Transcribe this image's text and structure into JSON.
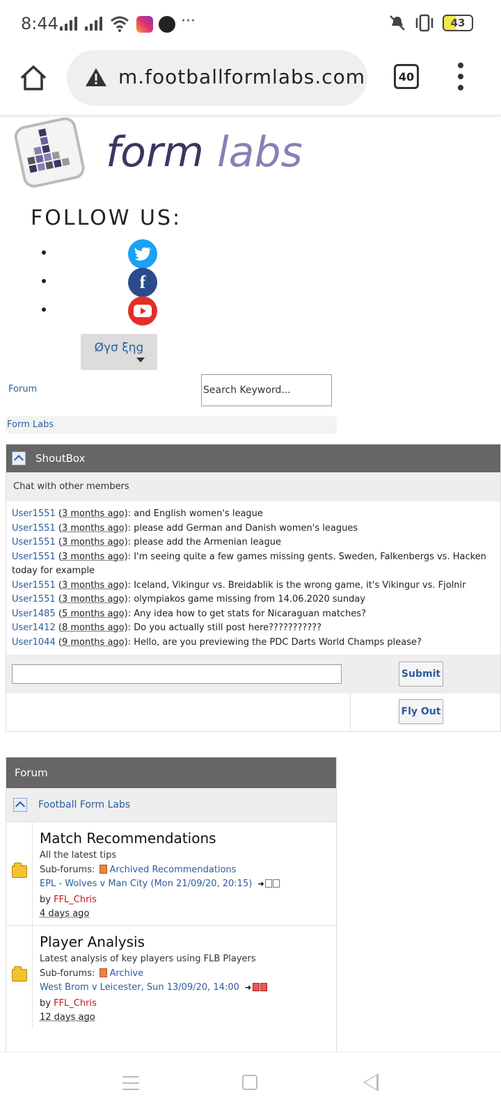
{
  "status_bar": {
    "time": "8:44",
    "more": "···",
    "battery": "43"
  },
  "browser": {
    "url": "m.footballformlabs.com",
    "tab_count": "40"
  },
  "logo": {
    "word1": "form",
    "word2": "labs"
  },
  "follow": {
    "heading": "FOLLOW US:",
    "icons": [
      "twitter-icon",
      "facebook-icon",
      "youtube-icon"
    ]
  },
  "language_button": "Øγσ ξηg",
  "nav": {
    "forum_link": "Forum",
    "search_placeholder": "Search Keyword...",
    "breadcrumb": "Form Labs"
  },
  "shoutbox": {
    "title": "ShoutBox",
    "subtitle": "Chat with other members",
    "messages": [
      {
        "user": "User1551",
        "ago": "3 months ago",
        "text": "and English women's league"
      },
      {
        "user": "User1551",
        "ago": "3 months ago",
        "text": "please add German and Danish women's leagues"
      },
      {
        "user": "User1551",
        "ago": "3 months ago",
        "text": "please add the Armenian league"
      },
      {
        "user": "User1551",
        "ago": "3 months ago",
        "text": "I'm seeing quite a few games missing gents. Sweden, Falkenbergs vs. Hacken today for example"
      },
      {
        "user": "User1551",
        "ago": "3 months ago",
        "text": "Iceland, Vikingur vs. Breidablik is the wrong game, it's Vikingur vs. Fjolnir"
      },
      {
        "user": "User1551",
        "ago": "3 months ago",
        "text": "olympiakos game missing from 14.06.2020 sunday"
      },
      {
        "user": "User1485",
        "ago": "5 months ago",
        "text": "Any idea how to get stats for Nicaraguan matches?"
      },
      {
        "user": "User1412",
        "ago": "8 months ago",
        "text": "Do you actually still post here???????????"
      },
      {
        "user": "User1044",
        "ago": "9 months ago",
        "text": "Hello, are you previewing the PDC Darts World Champs please?"
      }
    ],
    "submit_label": "Submit",
    "flyout_label": "Fly Out"
  },
  "forum": {
    "header": "Forum",
    "category": "Football Form Labs",
    "rows": [
      {
        "title": "Match Recommendations",
        "desc": "All the latest tips",
        "sub_label": "Sub-forums:",
        "sub_link": "Archived Recommendations",
        "last_post": "EPL - Wolves v Man City (Mon 21/09/20, 20:15)",
        "by": "by",
        "author": "FFL_Chris",
        "time": "4 days ago"
      },
      {
        "title": "Player Analysis",
        "desc": "Latest analysis of key players using FLB Players",
        "sub_label": "Sub-forums:",
        "sub_link": "Archive",
        "last_post": "West Brom v Leicester, Sun 13/09/20, 14:00",
        "by": "by",
        "author": "FFL_Chris",
        "time": "12 days ago"
      }
    ]
  }
}
